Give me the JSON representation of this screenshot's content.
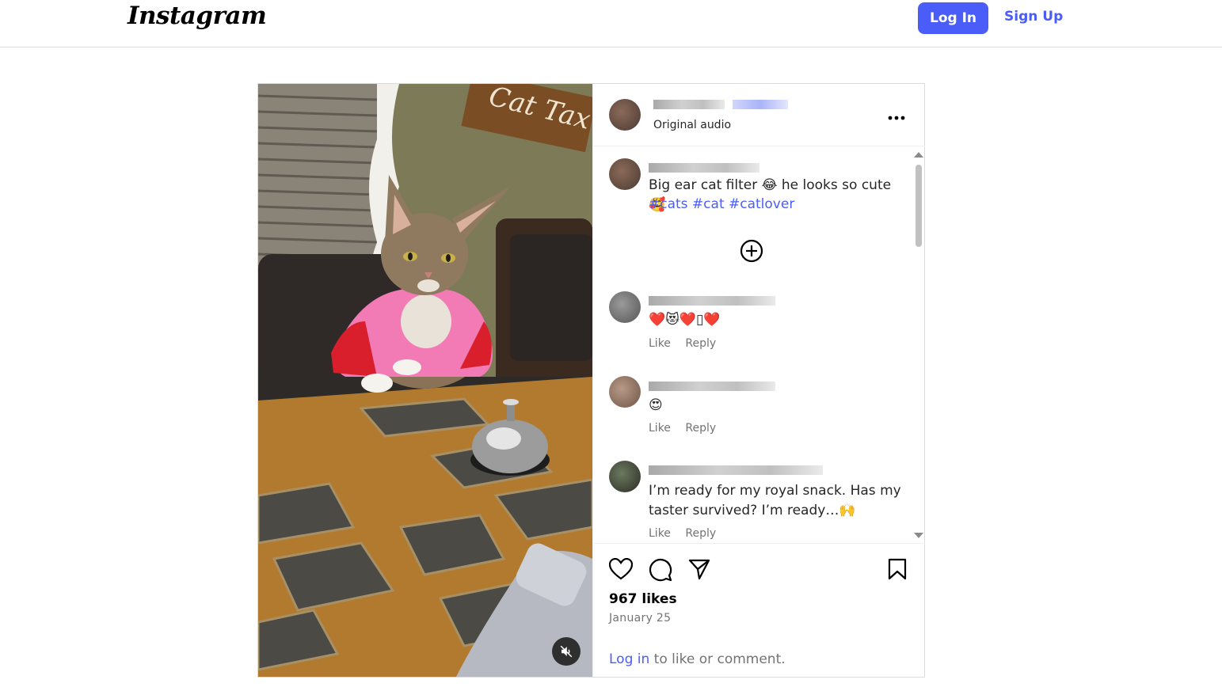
{
  "nav": {
    "logo": "Instagram",
    "login_label": "Log In",
    "signup_label": "Sign Up"
  },
  "post": {
    "audio_label": "Original audio",
    "more_label": "...",
    "caption": {
      "text": "Big ear cat filter 😂 he looks so cute 🥰",
      "hashtags": "#cats #cat #catlover"
    },
    "comments": [
      {
        "text": "❤️😻❤️▯❤️",
        "like": "Like",
        "reply": "Reply"
      },
      {
        "text": "😍",
        "like": "Like",
        "reply": "Reply"
      },
      {
        "text": "I’m ready for my royal snack. Has my taster survived? I’m ready…🙌",
        "like": "Like",
        "reply": "Reply"
      }
    ],
    "likes": "967 likes",
    "date": "January 25",
    "login_prompt": {
      "link": "Log in",
      "rest": " to like or comment."
    }
  },
  "media": {
    "sign_text": "Cat Tax"
  },
  "colors": {
    "accent": "#4a5df9",
    "muted": "#737373",
    "border": "#dbdbdb"
  },
  "icons": [
    "heart-icon",
    "comment-icon",
    "share-icon",
    "bookmark-icon",
    "mute-icon",
    "plus-circle-icon",
    "more-icon"
  ]
}
